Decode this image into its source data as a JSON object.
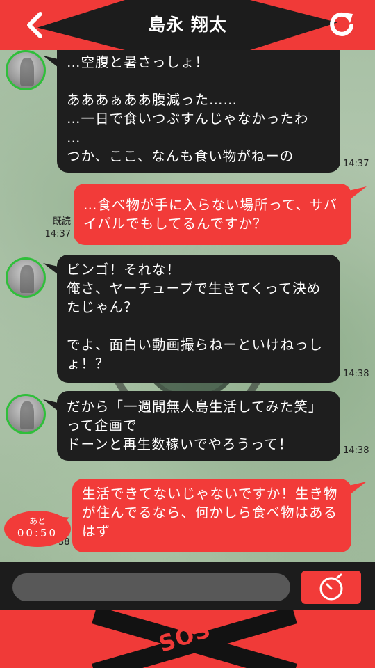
{
  "header": {
    "title": "島永 翔太",
    "back_icon": "chevron-left-icon",
    "reload_icon": "refresh-icon"
  },
  "colors": {
    "accent_red": "#f23b39",
    "dark": "#1e1e1e",
    "online_ring": "#2fbf3a"
  },
  "messages": [
    {
      "side": "left",
      "text": "…空腹と暑さっしょ！\n\nあああぁああ腹減った……\n…一日で食いつぶすんじゃなかったわ\n…\nつか、ここ、なんも食い物がねーの",
      "time": "14:37"
    },
    {
      "side": "right",
      "text": "…食べ物が手に入らない場所って、サバイバルでもしてるんですか？",
      "read": "既読",
      "time": "14:37"
    },
    {
      "side": "left",
      "text": "ビンゴ！それな！\n俺さ、ヤーチューブで生きてくって決めたじゃん？\n\nでよ、面白い動画撮らねーといけねっしょ！？",
      "time": "14:38"
    },
    {
      "side": "left",
      "text": "だから「一週間無人島生活してみた笑」って企画で\nドーンと再生数稼いでやろうって！",
      "time": "14:38"
    },
    {
      "side": "right",
      "text": "生活できてないじゃないですか！生き物が住んでるなら、何かしら食べ物はあるはず",
      "time": "38"
    }
  ],
  "timer": {
    "label": "あと",
    "value": "00:50"
  },
  "composer": {
    "value": "",
    "send_icon": "stopwatch-icon"
  },
  "footer": {
    "sos_label": "SOS"
  }
}
